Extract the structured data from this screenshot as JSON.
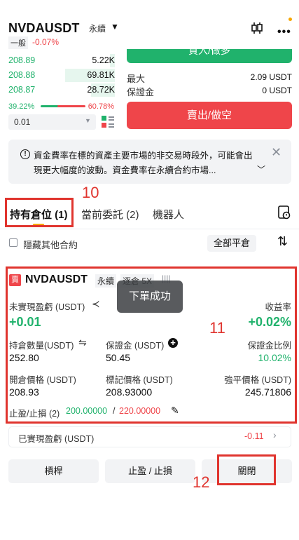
{
  "header": {
    "symbol": "NVDAUSDT",
    "contract_type": "永續",
    "category": "一般",
    "change": "-0.07%"
  },
  "order_book": {
    "bids": [
      {
        "price": "208.89",
        "qty": "5.22K",
        "depth": 0.1
      },
      {
        "price": "208.88",
        "qty": "69.81K",
        "depth": 1.0
      },
      {
        "price": "208.87",
        "qty": "28.72K",
        "depth": 0.47
      }
    ],
    "buy_ratio": "39.22%",
    "sell_ratio": "60.78%",
    "precision": "0.01"
  },
  "order_panel": {
    "buy_label": "買入/做多",
    "max_label": "最大",
    "max_value": "2.09 USDT",
    "margin_label": "保證金",
    "margin_value": "0 USDT",
    "sell_label": "賣出/做空"
  },
  "notice": {
    "text": "資金費率在標的資產主要市場的非交易時段外，可能會出現更大幅度的波動。資金費率在永續合約市場..."
  },
  "tabs": {
    "positions": "持有倉位 (1)",
    "orders": "當前委託 (2)",
    "bots": "機器人"
  },
  "filters": {
    "hide_other": "隱藏其他合約",
    "close_all": "全部平倉"
  },
  "position": {
    "side_tag": "賣",
    "symbol": "NVDAUSDT",
    "contract_type": "永續",
    "leverage": "逐倉 5X",
    "unrealized_pnl_label": "未實現盈虧 (USDT)",
    "unrealized_pnl": "+0.01",
    "roi_label": "收益率",
    "roi": "+0.02%",
    "qty_label": "持倉數量(USDT)",
    "qty": "252.80",
    "margin_label": "保證金 (USDT)",
    "margin": "50.45",
    "margin_ratio_label": "保證金比例",
    "margin_ratio": "10.02%",
    "entry_label": "開倉價格 (USDT)",
    "entry": "208.93",
    "mark_label": "標記價格 (USDT)",
    "mark": "208.93000",
    "liq_label": "強平價格 (USDT)",
    "liq": "245.71806",
    "tpsl_label": "止盈/止損 (2)",
    "tp": "200.00000",
    "sl": "220.00000"
  },
  "toast": "下單成功",
  "realized": {
    "label": "已實現盈虧 (USDT)",
    "value": "-0.11"
  },
  "buttons": {
    "leverage": "槓桿",
    "tpsl": "止盈 / 止損",
    "close": "關閉"
  },
  "annotations": {
    "tab_box": "10",
    "card_box": "11",
    "close_box": "12"
  }
}
